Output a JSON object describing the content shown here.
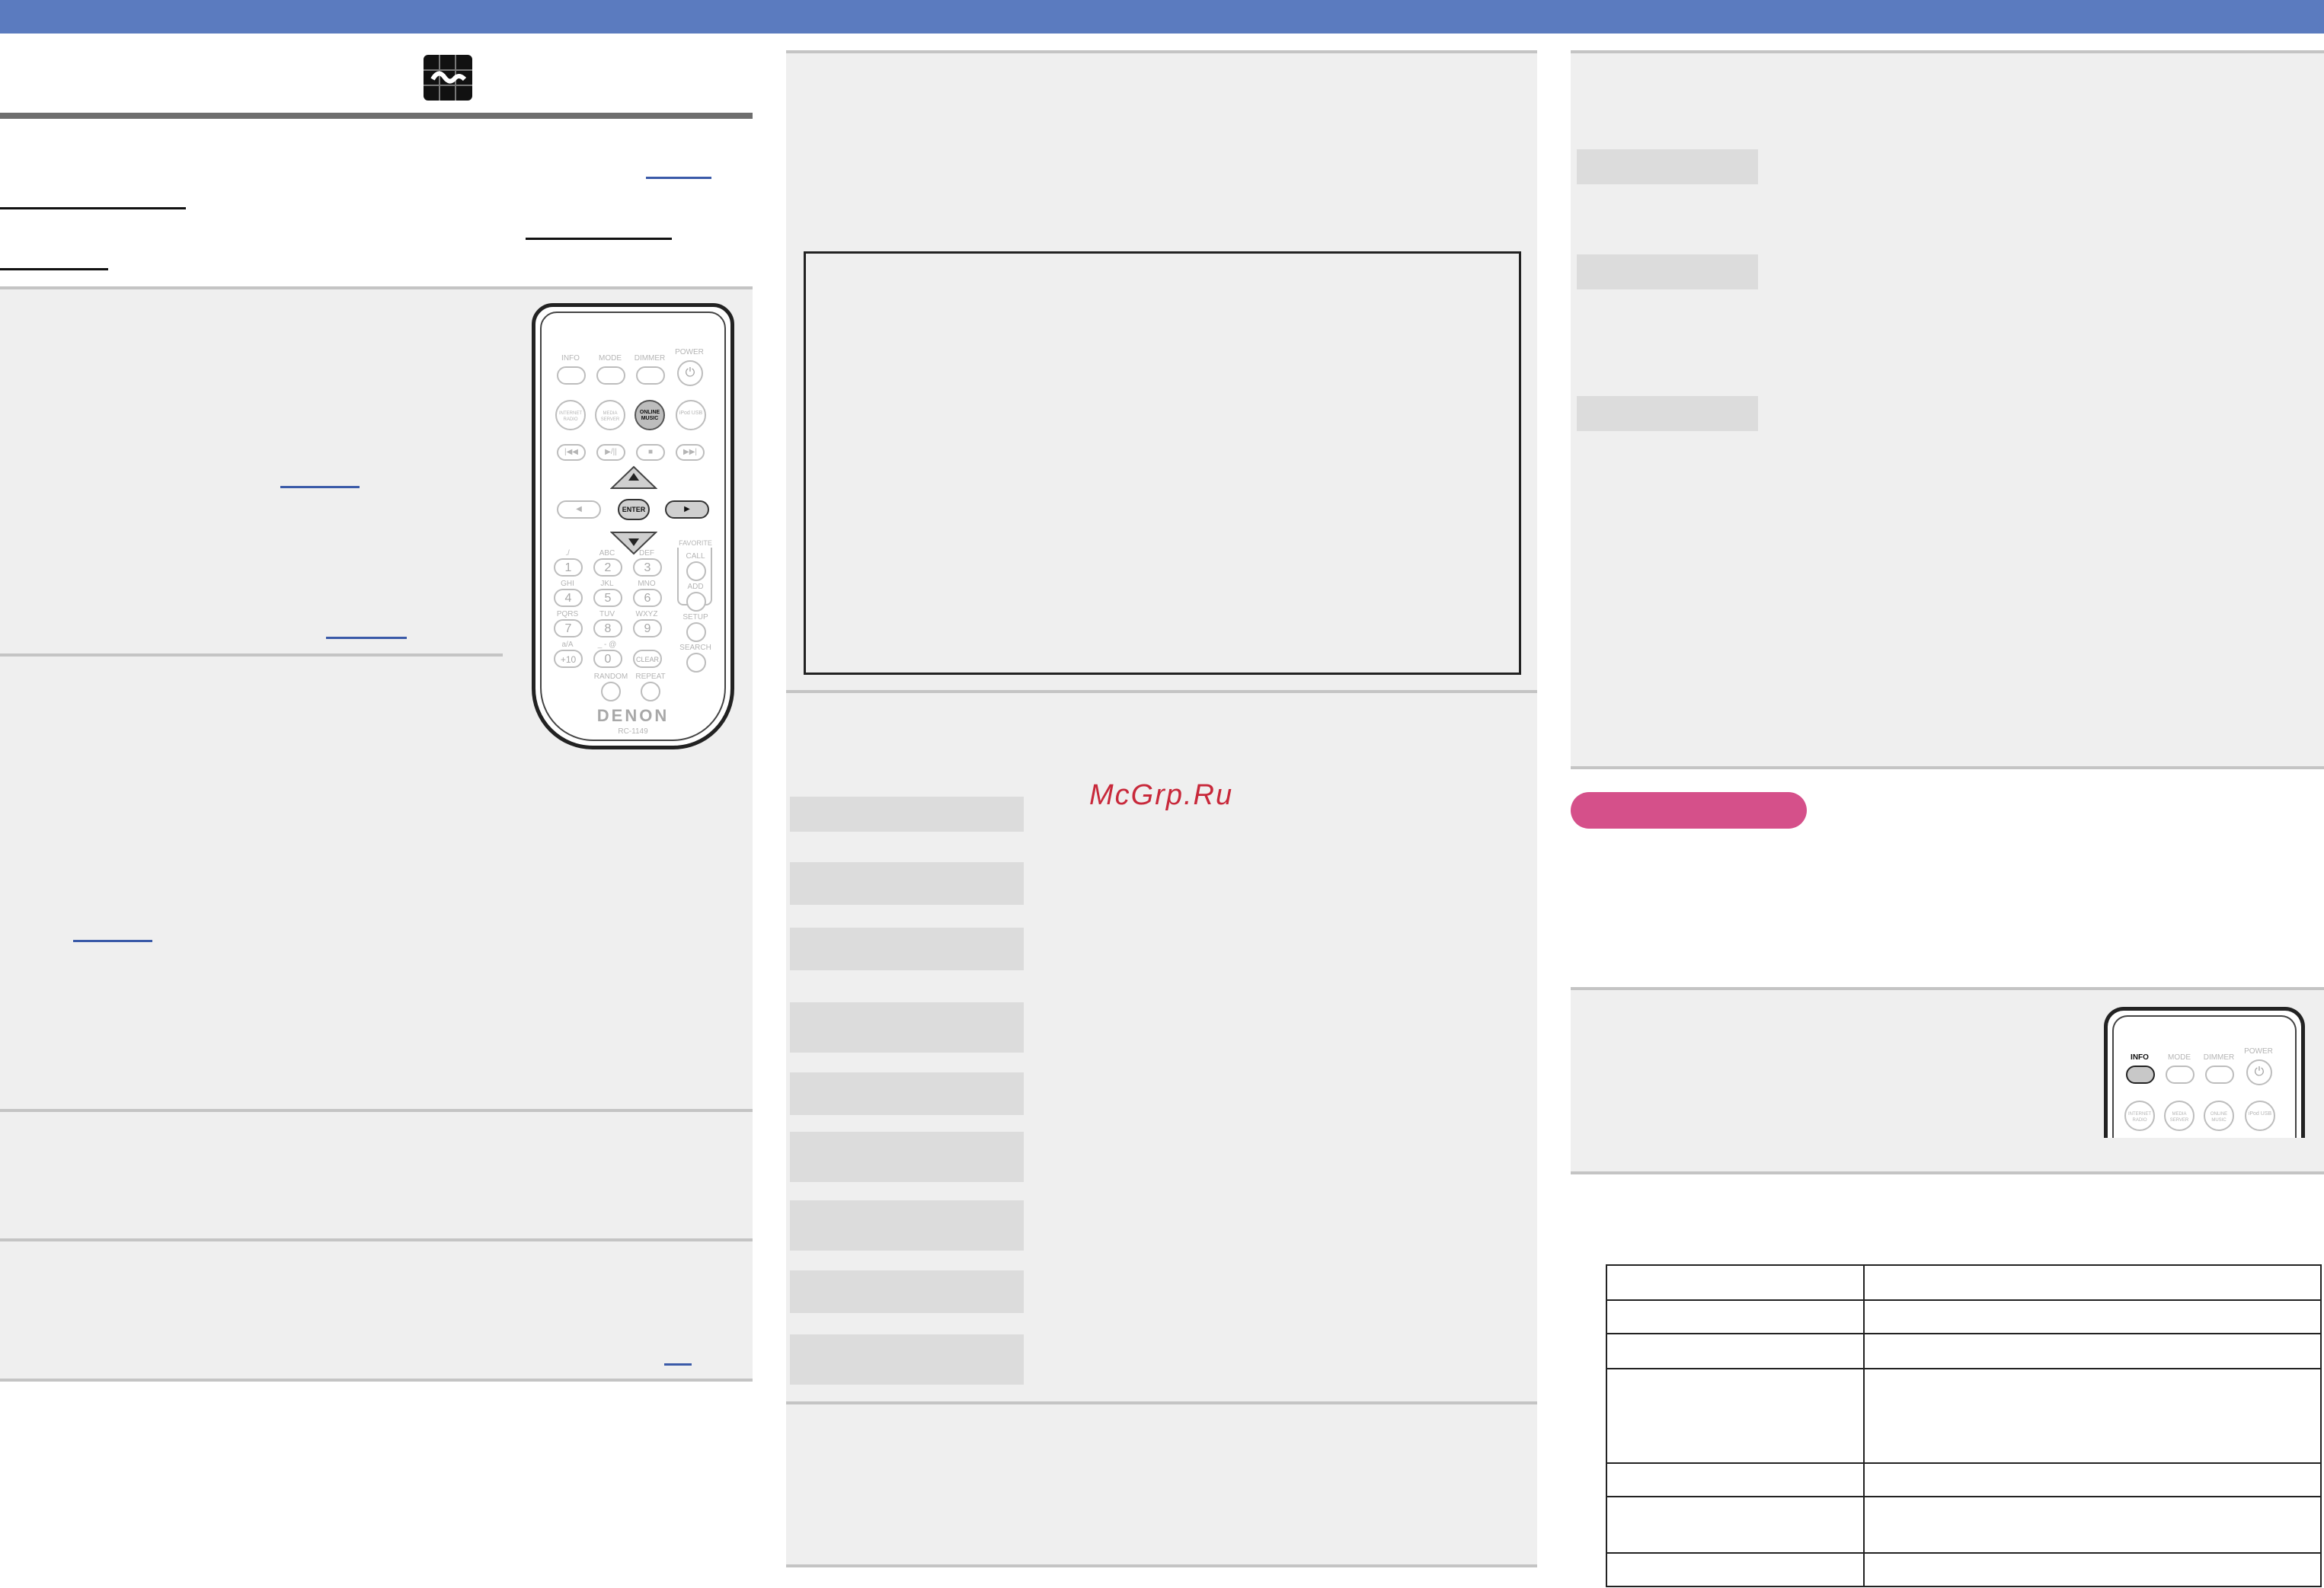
{
  "header": {
    "logo_icon": "lastfm-logo-icon",
    "accent_color": "#5b7bbf"
  },
  "watermark": {
    "text": "McGrp.Ru"
  },
  "remote_main": {
    "buttons_row1": [
      "INFO",
      "MODE",
      "DIMMER",
      "POWER"
    ],
    "buttons_row2": [
      "INTERNET RADIO",
      "MEDIA SERVER",
      "ONLINE MUSIC",
      "iPod USB"
    ],
    "transport": [
      "|◀◀",
      "▶/||",
      "■",
      "▶▶|"
    ],
    "enter_label": "ENTER",
    "favorite_label": "FAVORITE",
    "call_label": "CALL",
    "add_label": "ADD",
    "setup_label": "SETUP",
    "search_label": "SEARCH",
    "number_keys": [
      {
        "sub": "./",
        "num": "1"
      },
      {
        "sub": "ABC",
        "num": "2"
      },
      {
        "sub": "DEF",
        "num": "3"
      },
      {
        "sub": "GHI",
        "num": "4"
      },
      {
        "sub": "JKL",
        "num": "5"
      },
      {
        "sub": "MNO",
        "num": "6"
      },
      {
        "sub": "PQRS",
        "num": "7"
      },
      {
        "sub": "TUV",
        "num": "8"
      },
      {
        "sub": "WXYZ",
        "num": "9"
      },
      {
        "sub": "a/A",
        "num": "+10"
      },
      {
        "sub": "_ - @",
        "num": "0"
      },
      {
        "sub": "",
        "num": "CLEAR"
      }
    ],
    "random_label": "RANDOM",
    "repeat_label": "REPEAT",
    "brand": "DENON",
    "model": "RC-1149"
  },
  "remote_small": {
    "buttons_row1": [
      "INFO",
      "MODE",
      "DIMMER",
      "POWER"
    ],
    "buttons_row2": [
      "INTERNET RADIO",
      "MEDIA SERVER",
      "ONLINE MUSIC",
      "iPod USB"
    ]
  },
  "pill_color": "#d5508a"
}
